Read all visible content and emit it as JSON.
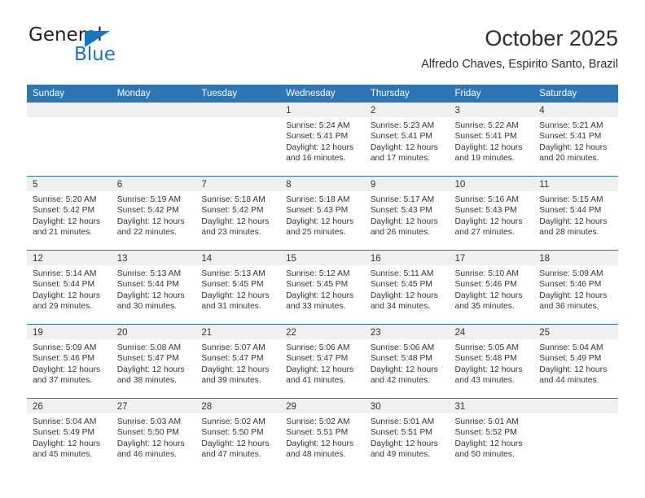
{
  "brand": {
    "name_part1": "General",
    "name_part2": "Blue",
    "accent_color": "#1b75bb"
  },
  "header": {
    "title": "October 2025",
    "subtitle": "Alfredo Chaves, Espirito Santo, Brazil"
  },
  "calendar": {
    "header_color": "#2e75b6",
    "weekday_headers": [
      "Sunday",
      "Monday",
      "Tuesday",
      "Wednesday",
      "Thursday",
      "Friday",
      "Saturday"
    ],
    "weeks": [
      [
        {
          "day": "",
          "empty": true
        },
        {
          "day": "",
          "empty": true
        },
        {
          "day": "",
          "empty": true
        },
        {
          "day": "1",
          "sunrise": "Sunrise: 5:24 AM",
          "sunset": "Sunset: 5:41 PM",
          "daylight": "Daylight: 12 hours and 16 minutes."
        },
        {
          "day": "2",
          "sunrise": "Sunrise: 5:23 AM",
          "sunset": "Sunset: 5:41 PM",
          "daylight": "Daylight: 12 hours and 17 minutes."
        },
        {
          "day": "3",
          "sunrise": "Sunrise: 5:22 AM",
          "sunset": "Sunset: 5:41 PM",
          "daylight": "Daylight: 12 hours and 19 minutes."
        },
        {
          "day": "4",
          "sunrise": "Sunrise: 5:21 AM",
          "sunset": "Sunset: 5:41 PM",
          "daylight": "Daylight: 12 hours and 20 minutes."
        }
      ],
      [
        {
          "day": "5",
          "sunrise": "Sunrise: 5:20 AM",
          "sunset": "Sunset: 5:42 PM",
          "daylight": "Daylight: 12 hours and 21 minutes."
        },
        {
          "day": "6",
          "sunrise": "Sunrise: 5:19 AM",
          "sunset": "Sunset: 5:42 PM",
          "daylight": "Daylight: 12 hours and 22 minutes."
        },
        {
          "day": "7",
          "sunrise": "Sunrise: 5:18 AM",
          "sunset": "Sunset: 5:42 PM",
          "daylight": "Daylight: 12 hours and 23 minutes."
        },
        {
          "day": "8",
          "sunrise": "Sunrise: 5:18 AM",
          "sunset": "Sunset: 5:43 PM",
          "daylight": "Daylight: 12 hours and 25 minutes."
        },
        {
          "day": "9",
          "sunrise": "Sunrise: 5:17 AM",
          "sunset": "Sunset: 5:43 PM",
          "daylight": "Daylight: 12 hours and 26 minutes."
        },
        {
          "day": "10",
          "sunrise": "Sunrise: 5:16 AM",
          "sunset": "Sunset: 5:43 PM",
          "daylight": "Daylight: 12 hours and 27 minutes."
        },
        {
          "day": "11",
          "sunrise": "Sunrise: 5:15 AM",
          "sunset": "Sunset: 5:44 PM",
          "daylight": "Daylight: 12 hours and 28 minutes."
        }
      ],
      [
        {
          "day": "12",
          "sunrise": "Sunrise: 5:14 AM",
          "sunset": "Sunset: 5:44 PM",
          "daylight": "Daylight: 12 hours and 29 minutes."
        },
        {
          "day": "13",
          "sunrise": "Sunrise: 5:13 AM",
          "sunset": "Sunset: 5:44 PM",
          "daylight": "Daylight: 12 hours and 30 minutes."
        },
        {
          "day": "14",
          "sunrise": "Sunrise: 5:13 AM",
          "sunset": "Sunset: 5:45 PM",
          "daylight": "Daylight: 12 hours and 31 minutes."
        },
        {
          "day": "15",
          "sunrise": "Sunrise: 5:12 AM",
          "sunset": "Sunset: 5:45 PM",
          "daylight": "Daylight: 12 hours and 33 minutes."
        },
        {
          "day": "16",
          "sunrise": "Sunrise: 5:11 AM",
          "sunset": "Sunset: 5:45 PM",
          "daylight": "Daylight: 12 hours and 34 minutes."
        },
        {
          "day": "17",
          "sunrise": "Sunrise: 5:10 AM",
          "sunset": "Sunset: 5:46 PM",
          "daylight": "Daylight: 12 hours and 35 minutes."
        },
        {
          "day": "18",
          "sunrise": "Sunrise: 5:09 AM",
          "sunset": "Sunset: 5:46 PM",
          "daylight": "Daylight: 12 hours and 36 minutes."
        }
      ],
      [
        {
          "day": "19",
          "sunrise": "Sunrise: 5:09 AM",
          "sunset": "Sunset: 5:46 PM",
          "daylight": "Daylight: 12 hours and 37 minutes."
        },
        {
          "day": "20",
          "sunrise": "Sunrise: 5:08 AM",
          "sunset": "Sunset: 5:47 PM",
          "daylight": "Daylight: 12 hours and 38 minutes."
        },
        {
          "day": "21",
          "sunrise": "Sunrise: 5:07 AM",
          "sunset": "Sunset: 5:47 PM",
          "daylight": "Daylight: 12 hours and 39 minutes."
        },
        {
          "day": "22",
          "sunrise": "Sunrise: 5:06 AM",
          "sunset": "Sunset: 5:47 PM",
          "daylight": "Daylight: 12 hours and 41 minutes."
        },
        {
          "day": "23",
          "sunrise": "Sunrise: 5:06 AM",
          "sunset": "Sunset: 5:48 PM",
          "daylight": "Daylight: 12 hours and 42 minutes."
        },
        {
          "day": "24",
          "sunrise": "Sunrise: 5:05 AM",
          "sunset": "Sunset: 5:48 PM",
          "daylight": "Daylight: 12 hours and 43 minutes."
        },
        {
          "day": "25",
          "sunrise": "Sunrise: 5:04 AM",
          "sunset": "Sunset: 5:49 PM",
          "daylight": "Daylight: 12 hours and 44 minutes."
        }
      ],
      [
        {
          "day": "26",
          "sunrise": "Sunrise: 5:04 AM",
          "sunset": "Sunset: 5:49 PM",
          "daylight": "Daylight: 12 hours and 45 minutes."
        },
        {
          "day": "27",
          "sunrise": "Sunrise: 5:03 AM",
          "sunset": "Sunset: 5:50 PM",
          "daylight": "Daylight: 12 hours and 46 minutes."
        },
        {
          "day": "28",
          "sunrise": "Sunrise: 5:02 AM",
          "sunset": "Sunset: 5:50 PM",
          "daylight": "Daylight: 12 hours and 47 minutes."
        },
        {
          "day": "29",
          "sunrise": "Sunrise: 5:02 AM",
          "sunset": "Sunset: 5:51 PM",
          "daylight": "Daylight: 12 hours and 48 minutes."
        },
        {
          "day": "30",
          "sunrise": "Sunrise: 5:01 AM",
          "sunset": "Sunset: 5:51 PM",
          "daylight": "Daylight: 12 hours and 49 minutes."
        },
        {
          "day": "31",
          "sunrise": "Sunrise: 5:01 AM",
          "sunset": "Sunset: 5:52 PM",
          "daylight": "Daylight: 12 hours and 50 minutes."
        },
        {
          "day": "",
          "empty": true
        }
      ]
    ]
  }
}
